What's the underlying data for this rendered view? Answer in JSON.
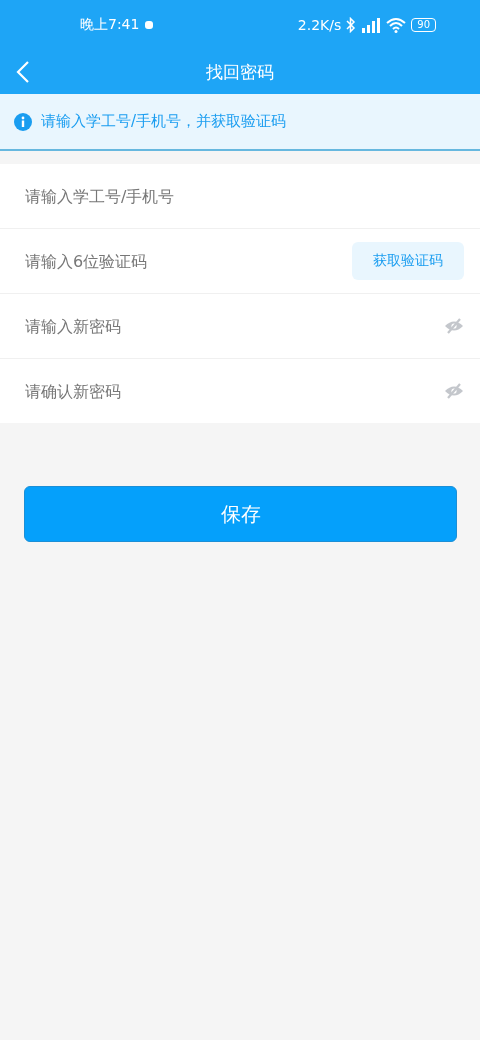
{
  "status_bar": {
    "time": "晚上7:41",
    "speed": "2.2K/s",
    "battery": "90"
  },
  "nav": {
    "title": "找回密码"
  },
  "notice": {
    "text": "请输入学工号/手机号，并获取验证码"
  },
  "fields": [
    {
      "kind": "text",
      "placeholder": "请输入学工号/手机号"
    },
    {
      "kind": "code",
      "placeholder": "请输入6位验证码",
      "button": "获取验证码"
    },
    {
      "kind": "password",
      "placeholder": "请输入新密码"
    },
    {
      "kind": "password",
      "placeholder": "请确认新密码"
    }
  ],
  "save_button": "保存"
}
